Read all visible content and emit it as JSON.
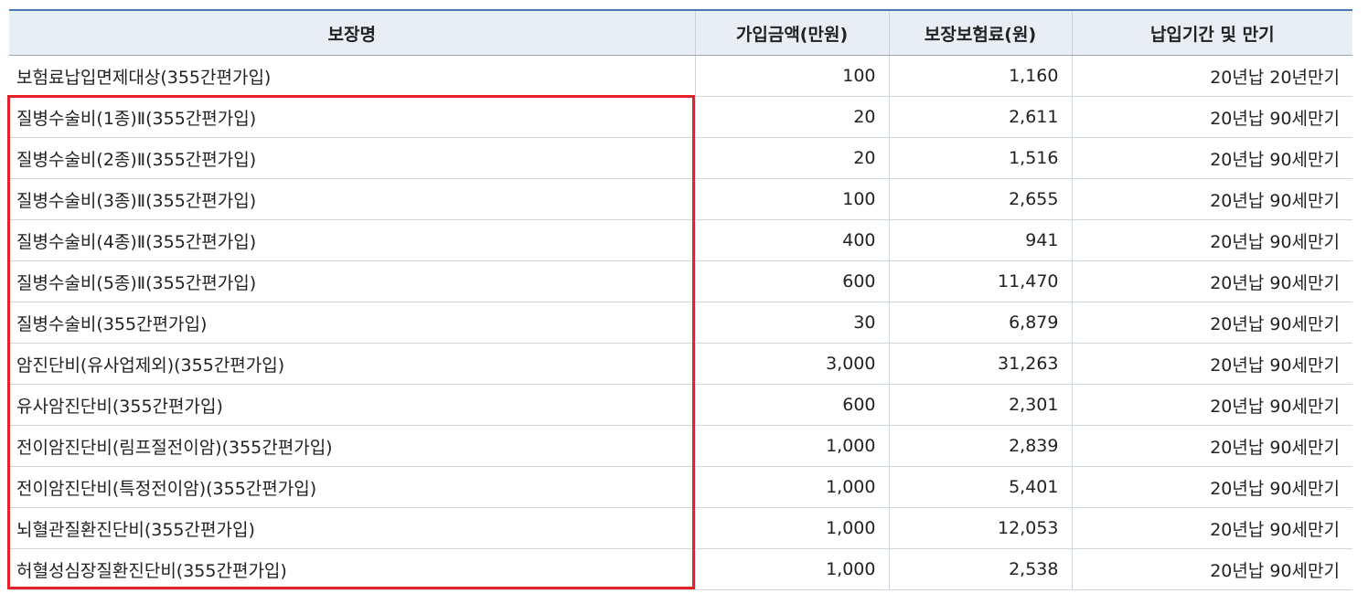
{
  "table": {
    "headers": [
      "보장명",
      "가입금액(만원)",
      "보장보험료(원)",
      "납입기간 및 만기"
    ],
    "rows": [
      [
        "보험료납입면제대상(355간편가입)",
        "100",
        "1,160",
        "20년납 20년만기"
      ],
      [
        "질병수술비(1종)Ⅱ(355간편가입)",
        "20",
        "2,611",
        "20년납 90세만기"
      ],
      [
        "질병수술비(2종)Ⅱ(355간편가입)",
        "20",
        "1,516",
        "20년납 90세만기"
      ],
      [
        "질병수술비(3종)Ⅱ(355간편가입)",
        "100",
        "2,655",
        "20년납 90세만기"
      ],
      [
        "질병수술비(4종)Ⅱ(355간편가입)",
        "400",
        "941",
        "20년납 90세만기"
      ],
      [
        "질병수술비(5종)Ⅱ(355간편가입)",
        "600",
        "11,470",
        "20년납 90세만기"
      ],
      [
        "질병수술비(355간편가입)",
        "30",
        "6,879",
        "20년납 90세만기"
      ],
      [
        "암진단비(유사업제외)(355간편가입)",
        "3,000",
        "31,263",
        "20년납 90세만기"
      ],
      [
        "유사암진단비(355간편가입)",
        "600",
        "2,301",
        "20년납 90세만기"
      ],
      [
        "전이암진단비(림프절전이암)(355간편가입)",
        "1,000",
        "2,839",
        "20년납 90세만기"
      ],
      [
        "전이암진단비(특정전이암)(355간편가입)",
        "1,000",
        "5,401",
        "20년납 90세만기"
      ],
      [
        "뇌혈관질환진단비(355간편가입)",
        "1,000",
        "12,053",
        "20년납 90세만기"
      ],
      [
        "허혈성심장질환진단비(355간편가입)",
        "1,000",
        "2,538",
        "20년납 90세만기"
      ]
    ]
  },
  "colors": {
    "header_bg": "#e9eef4",
    "header_top_border": "#4a78b0",
    "highlight_border": "#e52029"
  }
}
